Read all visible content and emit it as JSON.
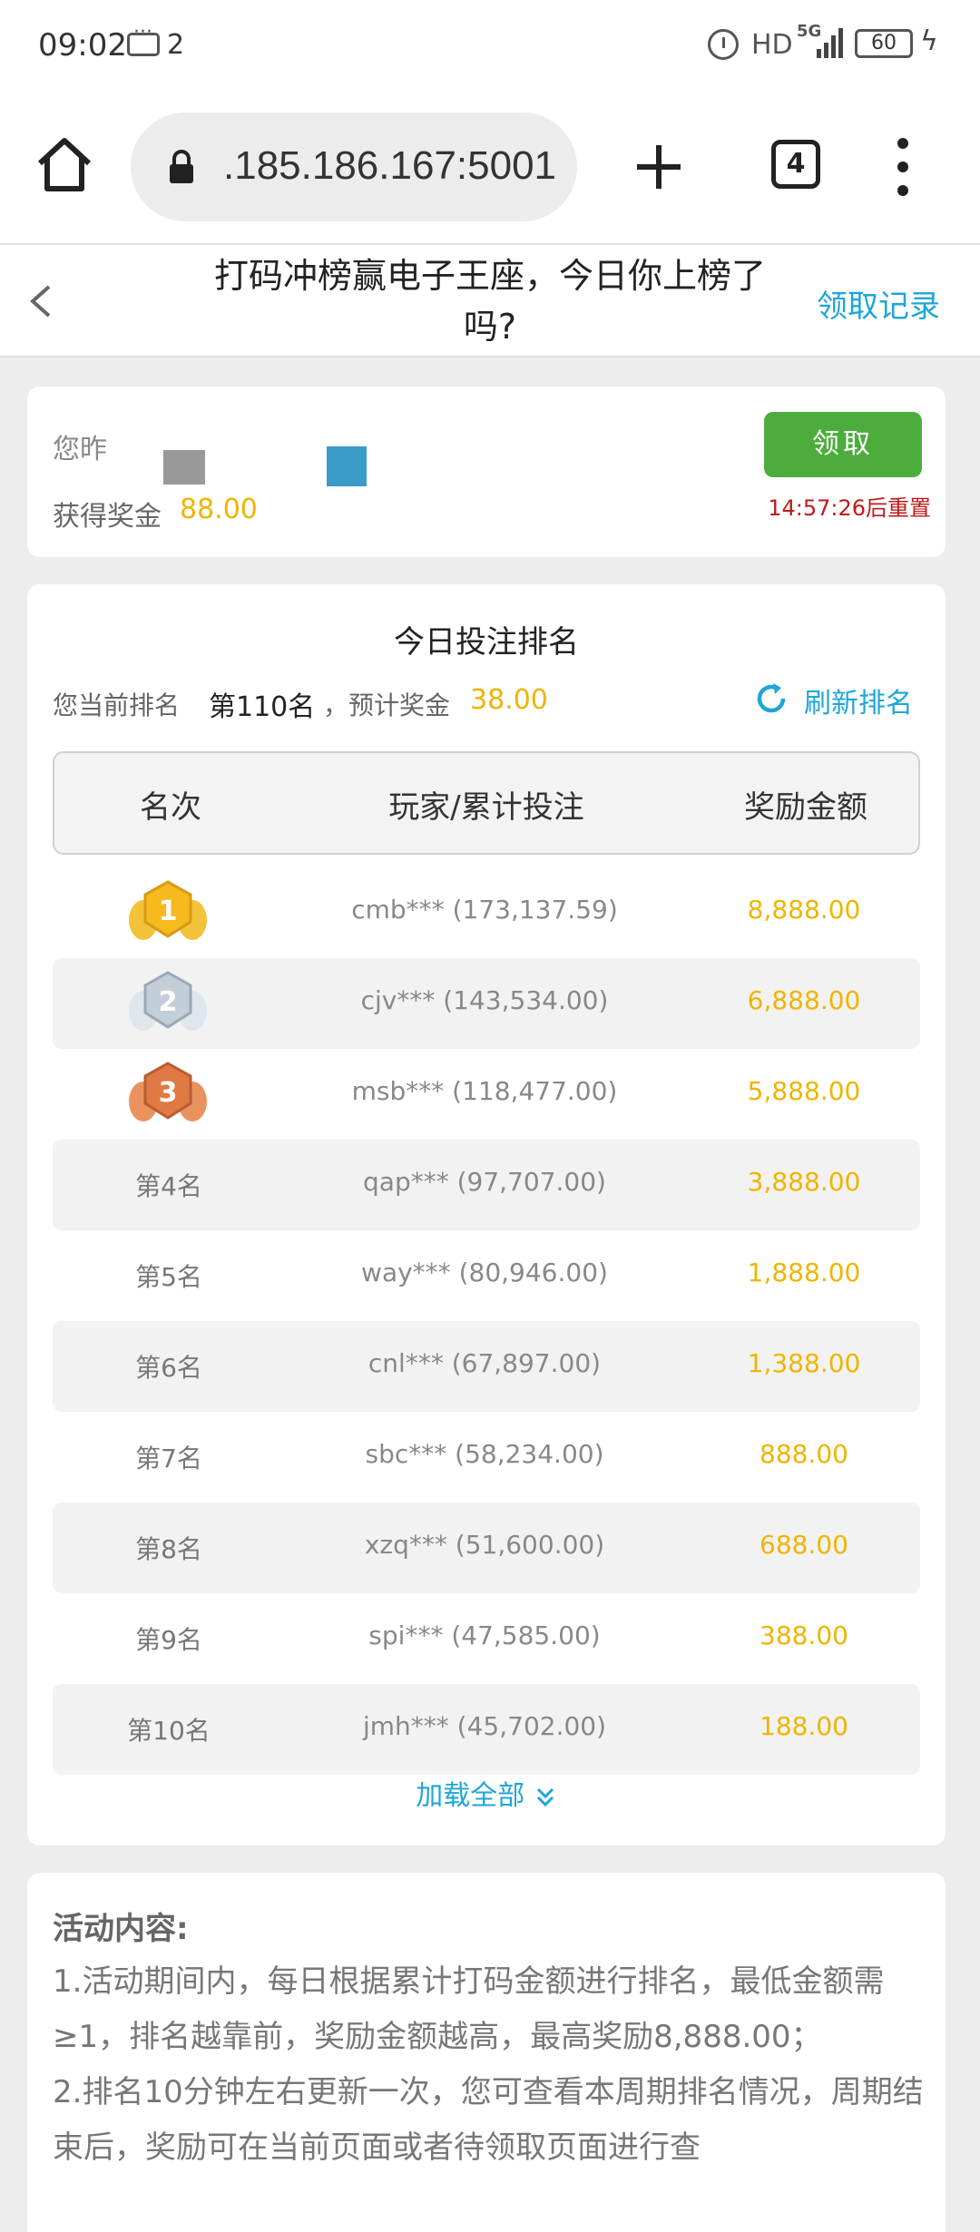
{
  "status_bar": {
    "time": "09:02",
    "notification_count": "2",
    "network": "HD",
    "network_gen": "5G",
    "battery": "60"
  },
  "browser": {
    "url": ".185.186.167:5001",
    "tab_count": "4"
  },
  "header": {
    "title": "打码冲榜赢电子王座，今日你上榜了吗?",
    "record_link": "领取记录"
  },
  "reward": {
    "prefix": "您昨",
    "label": "获得奖金",
    "amount": "88.00",
    "claim_button": "领取",
    "reset_time": "14:57:26后重置"
  },
  "ranking": {
    "title": "今日投注排名",
    "my_rank_label": "您当前排名",
    "my_rank": "第110名",
    "estimate_label": "，预计奖金",
    "estimate": "38.00",
    "refresh_label": "刷新排名",
    "headers": {
      "rank": "名次",
      "player": "玩家/累计投注",
      "prize": "奖励金额"
    },
    "rows": [
      {
        "rank": "1",
        "player": "cmb*** (173,137.59)",
        "prize": "8,888.00",
        "medal": "gold-medal"
      },
      {
        "rank": "2",
        "player": "cjv*** (143,534.00)",
        "prize": "6,888.00",
        "medal": "silver-medal"
      },
      {
        "rank": "3",
        "player": "msb*** (118,477.00)",
        "prize": "5,888.00",
        "medal": "bronze-medal"
      },
      {
        "rank": "第4名",
        "player": "qap*** (97,707.00)",
        "prize": "3,888.00"
      },
      {
        "rank": "第5名",
        "player": "way*** (80,946.00)",
        "prize": "1,888.00"
      },
      {
        "rank": "第6名",
        "player": "cnl*** (67,897.00)",
        "prize": "1,388.00"
      },
      {
        "rank": "第7名",
        "player": "sbc*** (58,234.00)",
        "prize": "888.00"
      },
      {
        "rank": "第8名",
        "player": "xzq*** (51,600.00)",
        "prize": "688.00"
      },
      {
        "rank": "第9名",
        "player": "spi*** (47,585.00)",
        "prize": "388.00"
      },
      {
        "rank": "第10名",
        "player": "jmh*** (45,702.00)",
        "prize": "188.00"
      }
    ],
    "load_all": "加载全部"
  },
  "activity": {
    "title": "活动内容:",
    "line1": "1.活动期间内，每日根据累计打码金额进行排名，最低金额需≥1，排名越靠前，奖励金额越高，最高奖励8,888.00；",
    "line2": "2.排名10分钟左右更新一次，您可查看本周期排名情况，周期结束后，奖励可在当前页面或者待领取页面进行查"
  },
  "colors": {
    "accent_blue": "#1ea6d8",
    "gold_text": "#f0b400",
    "claim_green": "#4cad3c",
    "reset_red": "#c01818"
  }
}
